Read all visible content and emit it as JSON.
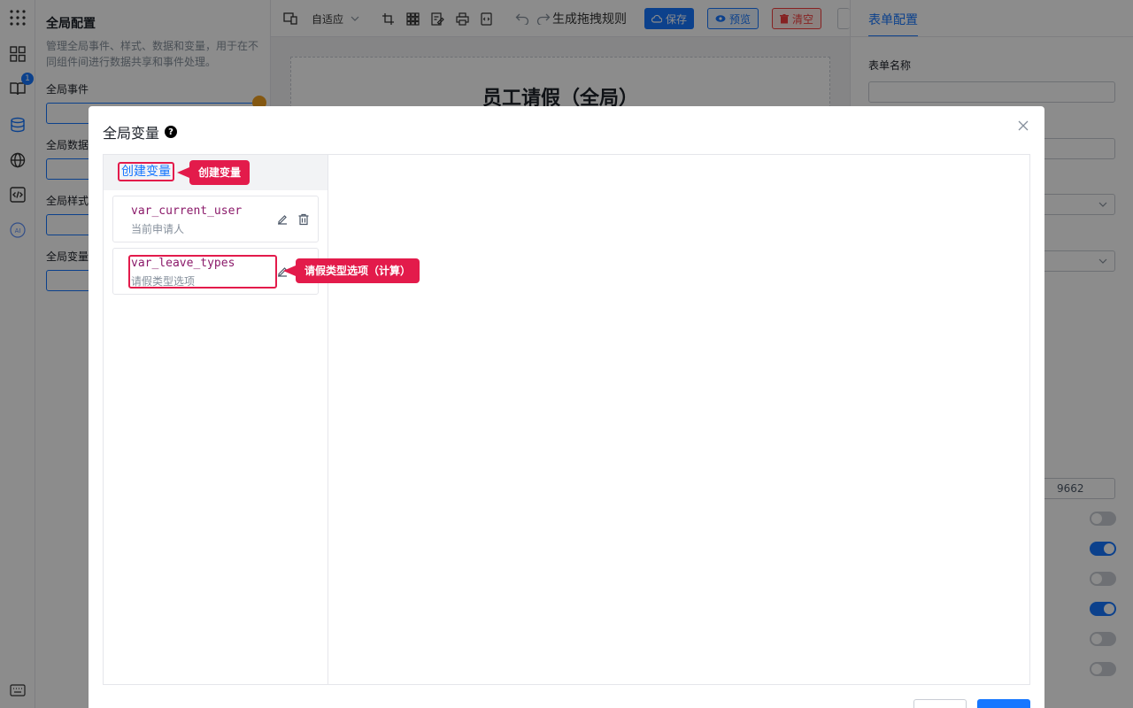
{
  "left_panel": {
    "title": "全局配置",
    "description": "管理全局事件、样式、数据和变量，用于在不同组件间进行数据共享和事件处理。",
    "sections": [
      "全局事件",
      "全局数据",
      "全局样式",
      "全局变量"
    ]
  },
  "icon_bar": {
    "badge_count": "1"
  },
  "toolbar": {
    "adapt_label": "自适应",
    "rules_label": "生成拖拽规则",
    "save_label": "保存",
    "preview_label": "预览",
    "clear_label": "清空"
  },
  "canvas": {
    "form_title": "员工请假（全局）"
  },
  "right_panel": {
    "tab_label": "表单配置",
    "form_name_label": "表单名称",
    "partial_value": "9662"
  },
  "modal": {
    "title": "全局变量",
    "create_label": "创建变量",
    "variables": [
      {
        "name": "var_current_user",
        "desc": "当前申请人"
      },
      {
        "name": "var_leave_types",
        "desc": "请假类型选项"
      }
    ]
  },
  "callouts": {
    "create": "创建变量",
    "leave_types": "请假类型选项（计算）"
  },
  "colors": {
    "accent": "#1677ff",
    "callout": "#e31b4b",
    "danger": "#f53f3f"
  }
}
